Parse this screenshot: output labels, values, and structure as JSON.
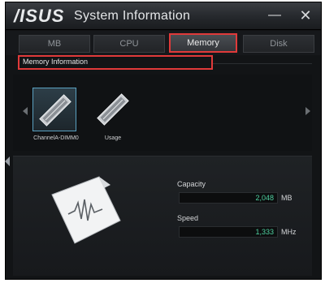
{
  "window": {
    "logo_text": "/ISUS",
    "title": "System Information",
    "minimize_glyph": "—",
    "close_glyph": "✕"
  },
  "tabs": [
    {
      "label": "MB",
      "selected": false
    },
    {
      "label": "CPU",
      "selected": false
    },
    {
      "label": "Memory",
      "selected": true
    },
    {
      "label": "Disk",
      "selected": false
    }
  ],
  "section": {
    "header": "Memory Information"
  },
  "modules": [
    {
      "label": "ChannelA-DIMM0",
      "selected": true,
      "icon": "ram-module-icon"
    },
    {
      "label": "Usage",
      "selected": false,
      "icon": "ram-module-icon"
    }
  ],
  "details": {
    "capacity_label": "Capacity",
    "capacity_value": "2,048",
    "capacity_unit": "MB",
    "speed_label": "Speed",
    "speed_value": "1,333",
    "speed_unit": "MHz"
  },
  "colors": {
    "highlight": "#e03a3a",
    "value_text": "#4ed0a0",
    "background": "#121416"
  }
}
